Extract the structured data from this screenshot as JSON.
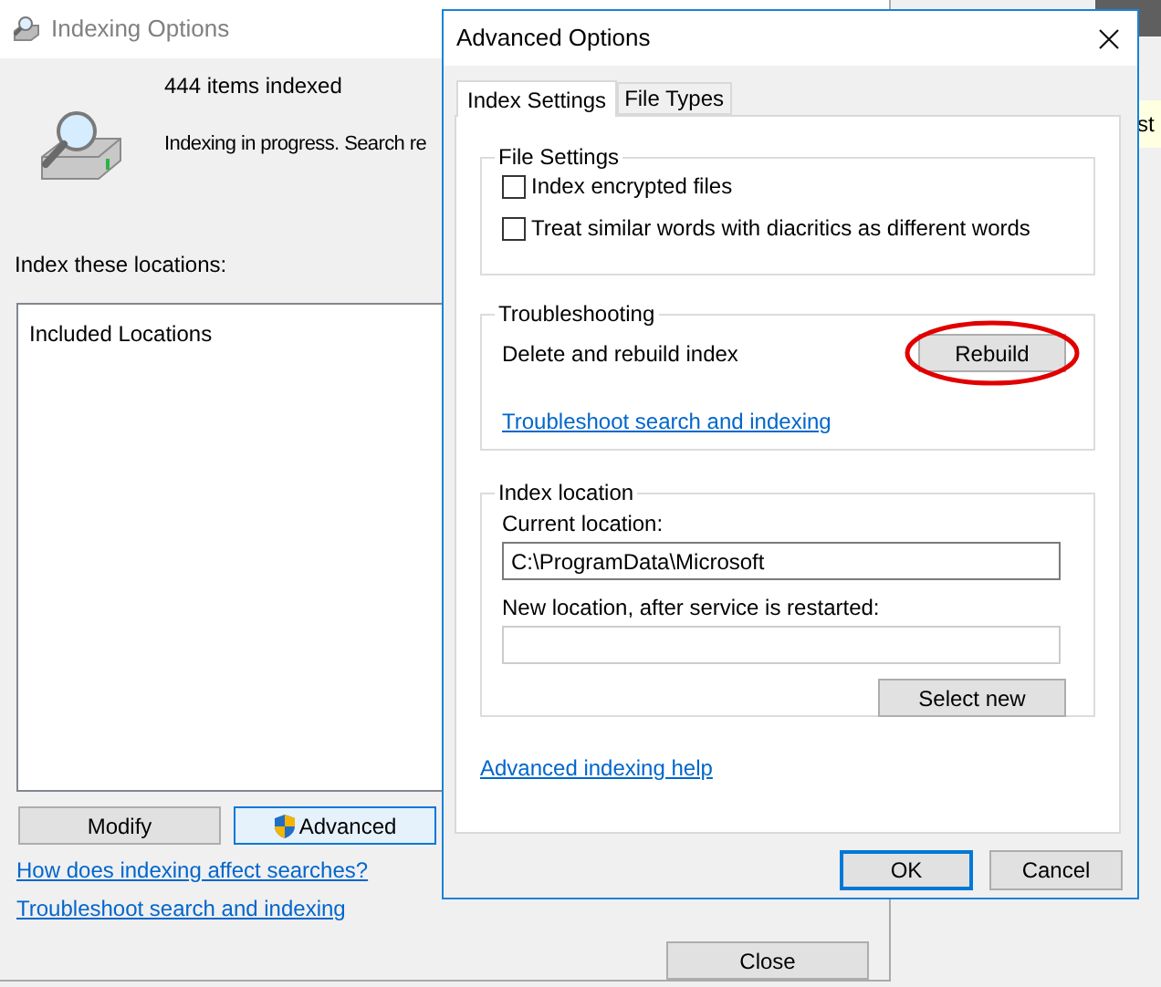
{
  "main_window": {
    "title": "Indexing Options",
    "items_indexed": "444 items indexed",
    "status": "Indexing in progress. Search re",
    "locations_label": "Index these locations:",
    "list_header": "Included Locations",
    "buttons": [
      {
        "label": "Modify",
        "kind": "plain"
      },
      {
        "label": "Advanced",
        "kind": "shield"
      }
    ],
    "links": [
      "How does indexing affect searches?",
      "Troubleshoot search and indexing"
    ],
    "close_button": "Close"
  },
  "dialog": {
    "title": "Advanced Options",
    "tabs": [
      {
        "label": "Index Settings",
        "selected": true
      },
      {
        "label": "File Types",
        "selected": false
      }
    ],
    "file_settings": {
      "title": "File Settings",
      "options": [
        {
          "label": "Index encrypted files",
          "checked": false
        },
        {
          "label": "Treat similar words with diacritics as different words",
          "checked": false
        }
      ]
    },
    "troubleshooting": {
      "title": "Troubleshooting",
      "label": "Delete and rebuild index",
      "button": "Rebuild",
      "link": "Troubleshoot search and indexing"
    },
    "index_location": {
      "title": "Index location",
      "current_label": "Current location:",
      "current_value": "C:\\ProgramData\\Microsoft",
      "new_label": "New location, after service is restarted:",
      "button": "Select new"
    },
    "help_link": "Advanced indexing help",
    "buttons": [
      {
        "label": "OK",
        "default": true
      },
      {
        "label": "Cancel",
        "default": false
      }
    ]
  },
  "background_window": {
    "text": "st"
  }
}
